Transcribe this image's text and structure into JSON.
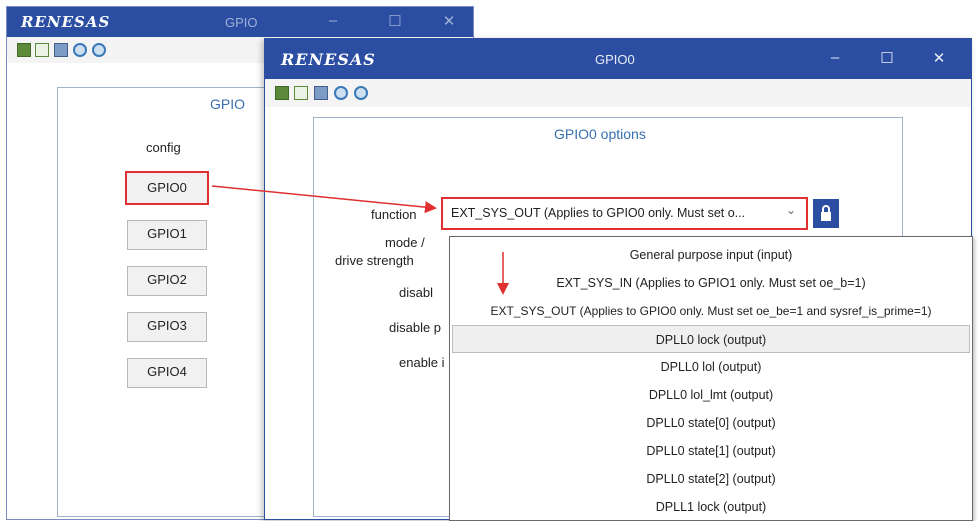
{
  "back_window": {
    "logo": "RENESAS",
    "title": "GPIO",
    "panel_title": "GPIO",
    "config_label": "config",
    "gpio_buttons": [
      "GPIO0",
      "GPIO1",
      "GPIO2",
      "GPIO3",
      "GPIO4"
    ]
  },
  "front_window": {
    "logo": "RENESAS",
    "title": "GPIO0",
    "panel_title": "GPIO0 options",
    "labels": {
      "function": "function",
      "mode": "mode /",
      "drive": "drive strength",
      "disable": "disabl",
      "disable_pu": "disable p",
      "enable": "enable i"
    },
    "function_select": {
      "value": "EXT_SYS_OUT (Applies to GPIO0 only.  Must set o...",
      "arrow": "⌄"
    }
  },
  "titlebar_controls": {
    "minimize": "–",
    "maximize": "☐",
    "close": "✕"
  },
  "dropdown": {
    "options": [
      "General purpose input (input)",
      "EXT_SYS_IN (Applies to GPIO1 only.  Must set oe_b=1)",
      "EXT_SYS_OUT (Applies to GPIO0 only.  Must set oe_be=1 and sysref_is_prime=1)",
      "DPLL0 lock (output)",
      "DPLL0 lol (output)",
      "DPLL0 lol_lmt (output)",
      "DPLL0 state[0] (output)",
      "DPLL0 state[1] (output)",
      "DPLL0 state[2] (output)",
      "DPLL1 lock (output)"
    ],
    "highlighted_index": 3
  },
  "colors": {
    "titlebar": "#2b4ea2",
    "highlight": "#e03030",
    "panel_title": "#3a6fb0",
    "lock_button": "#2b4ea2"
  },
  "icons": [
    "save-icon",
    "fit-icon",
    "print-icon",
    "zoom-out-icon",
    "zoom-in-icon",
    "lock-icon"
  ]
}
